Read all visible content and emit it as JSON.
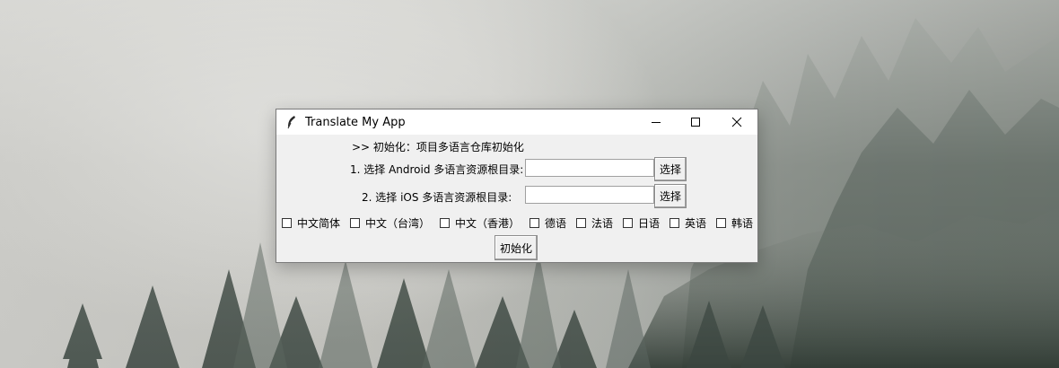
{
  "window": {
    "title": "Translate My App",
    "minimize_glyph": "—",
    "maximize_glyph": "☐",
    "close_glyph": "✕"
  },
  "form": {
    "heading": ">> 初始化：项目多语言仓库初始化",
    "android_label": "1. 选择 Android 多语言资源根目录:",
    "android_value": "",
    "android_button": "选择",
    "ios_label": "2. 选择 iOS 多语言资源根目录:",
    "ios_value": "",
    "ios_button": "选择",
    "languages": [
      {
        "label": "中文简体",
        "checked": false
      },
      {
        "label": "中文（台湾）",
        "checked": false
      },
      {
        "label": "中文（香港）",
        "checked": false
      },
      {
        "label": "德语",
        "checked": false
      },
      {
        "label": "法语",
        "checked": false
      },
      {
        "label": "日语",
        "checked": false
      },
      {
        "label": "英语",
        "checked": false
      },
      {
        "label": "韩语",
        "checked": false
      }
    ],
    "init_button": "初始化"
  },
  "icons": {
    "app": "feather-icon"
  }
}
